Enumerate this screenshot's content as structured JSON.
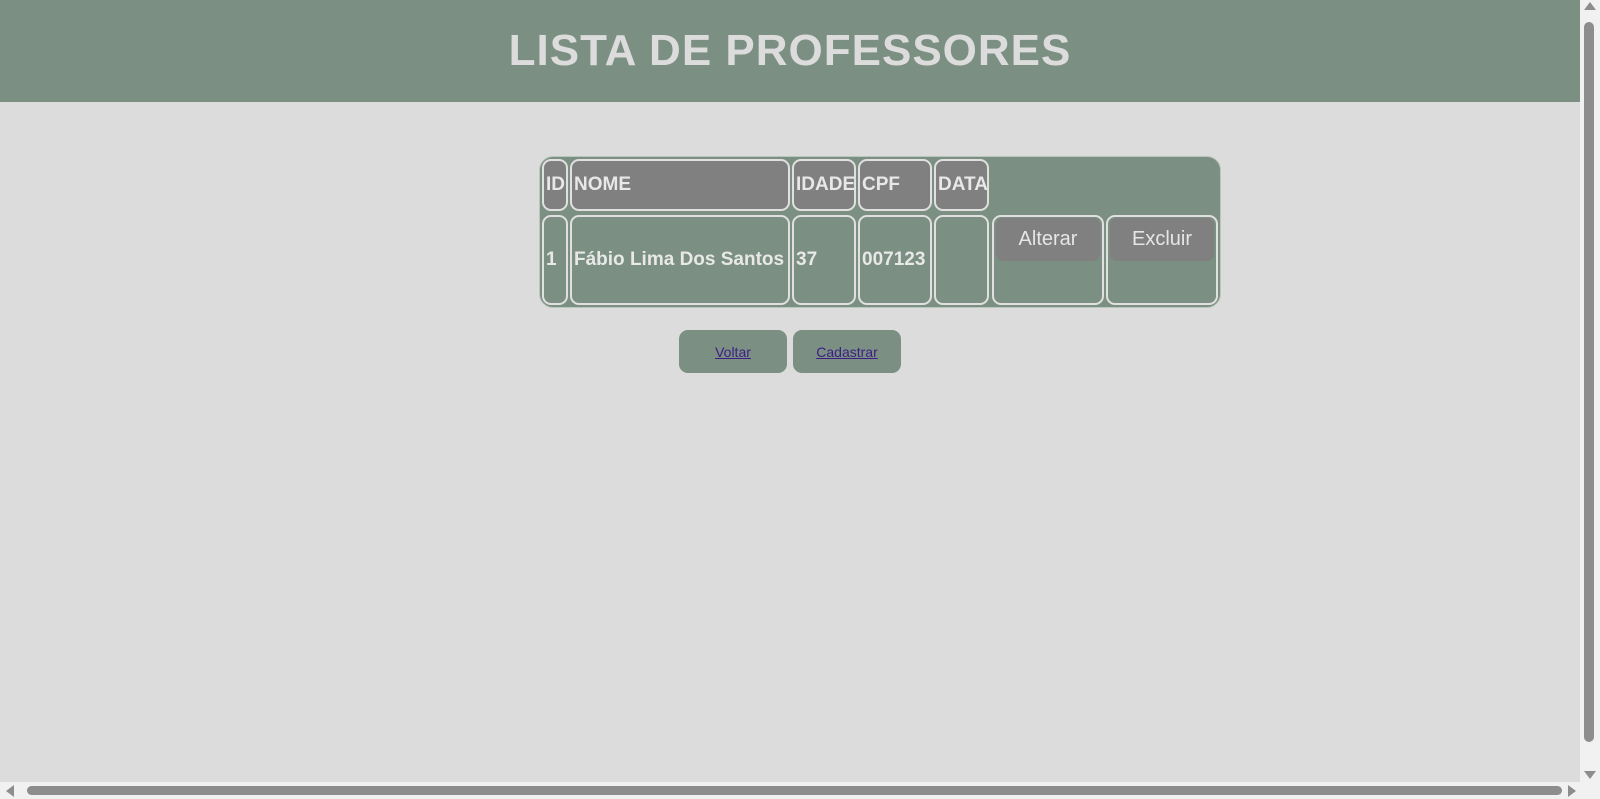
{
  "page": {
    "title": "LISTA DE PROFESSORES"
  },
  "table": {
    "headers": {
      "id": "ID",
      "nome": "NOME",
      "idade": "IDADE",
      "cpf": "CPF",
      "data": "DATA"
    },
    "rows": [
      {
        "id": "1",
        "nome": "Fábio Lima Dos Santos",
        "idade": "37",
        "cpf": "007123",
        "data": "",
        "alterar_label": "Alterar",
        "excluir_label": "Excluir"
      }
    ]
  },
  "nav": {
    "voltar_label": "Voltar",
    "cadastrar_label": "Cadastrar"
  },
  "colors": {
    "header_bg": "#7b8f82",
    "page_bg": "#dcdcdc",
    "table_head_bg": "#808080",
    "link_color": "#3c1e86"
  }
}
